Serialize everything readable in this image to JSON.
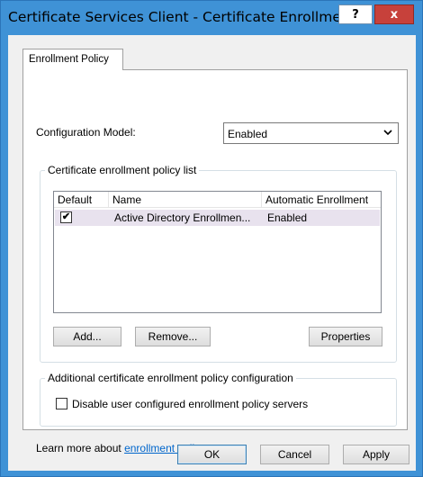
{
  "window": {
    "title": "Certificate Services Client - Certificate Enrollme...",
    "help_label": "?",
    "close_label": "x"
  },
  "tab": {
    "label": "Enrollment Policy"
  },
  "config": {
    "label": "Configuration Model:",
    "selected": "Enabled",
    "chevron": "⌵"
  },
  "policy_list": {
    "group_label": "Certificate enrollment policy list",
    "columns": [
      "Default",
      "Name",
      "Automatic Enrollment"
    ],
    "rows": [
      {
        "default_checked": "✔",
        "name": "Active Directory Enrollmen...",
        "auto": "Enabled"
      }
    ]
  },
  "buttons": {
    "add": "Add...",
    "remove": "Remove...",
    "properties": "Properties",
    "ok": "OK",
    "cancel": "Cancel",
    "apply": "Apply"
  },
  "additional": {
    "group_label": "Additional certificate enrollment policy configuration",
    "checkbox_label": "Disable user configured enrollment policy servers",
    "checked": false
  },
  "learn_more": {
    "prefix": "Learn more about",
    "link": "enrollment policy servers"
  }
}
